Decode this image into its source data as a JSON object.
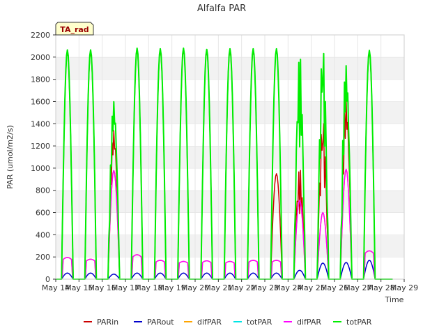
{
  "chart_data": {
    "type": "line",
    "title": "Alfalfa PAR",
    "xlabel": "Time",
    "ylabel": "PAR (umol/m2/s)",
    "ylim": [
      0,
      2200
    ],
    "yticks": [
      0,
      200,
      400,
      600,
      800,
      1000,
      1200,
      1400,
      1600,
      1800,
      2000,
      2200
    ],
    "xlim": [
      14,
      29
    ],
    "xticks": [
      14,
      15,
      16,
      17,
      18,
      19,
      20,
      21,
      22,
      23,
      24,
      25,
      26,
      27,
      28,
      29
    ],
    "xtick_labels": [
      "May 14",
      "May 15",
      "May 16",
      "May 17",
      "May 18",
      "May 19",
      "May 20",
      "May 21",
      "May 22",
      "May 23",
      "May 24",
      "May 25",
      "May 26",
      "May 27",
      "May 28",
      "May 29"
    ],
    "annotation": "TA_rad",
    "grid": "horizontal bands",
    "legend_position": "bottom",
    "days": [
      14.5,
      15.5,
      16.5,
      17.5,
      18.5,
      19.5,
      20.5,
      21.5,
      22.5,
      23.5,
      24.5,
      25.5,
      26.5,
      27.5
    ],
    "day_peaks": {
      "totPAR": [
        2065,
        2065,
        1660,
        2080,
        2075,
        2080,
        2070,
        2075,
        2075,
        2075,
        2040,
        2120,
        2020,
        2060
      ],
      "PARin": [
        2050,
        2050,
        1390,
        2065,
        2060,
        2065,
        2055,
        2060,
        2060,
        950,
        1010,
        1460,
        1700,
        2045
      ],
      "difPAR": [
        195,
        180,
        980,
        220,
        170,
        160,
        165,
        160,
        170,
        170,
        710,
        600,
        990,
        255
      ],
      "PARout": [
        55,
        55,
        45,
        55,
        55,
        55,
        55,
        55,
        55,
        55,
        80,
        145,
        150,
        170
      ]
    },
    "series": [
      {
        "name": "PARin",
        "color": "#cc0000"
      },
      {
        "name": "PARout",
        "color": "#0000cc"
      },
      {
        "name": "difPAR",
        "color": "#ffa500"
      },
      {
        "name": "totPAR",
        "color": "#00e5e5"
      },
      {
        "name": "difPAR",
        "color": "#ff00ff"
      },
      {
        "name": "totPAR",
        "color": "#00ee00"
      }
    ]
  }
}
